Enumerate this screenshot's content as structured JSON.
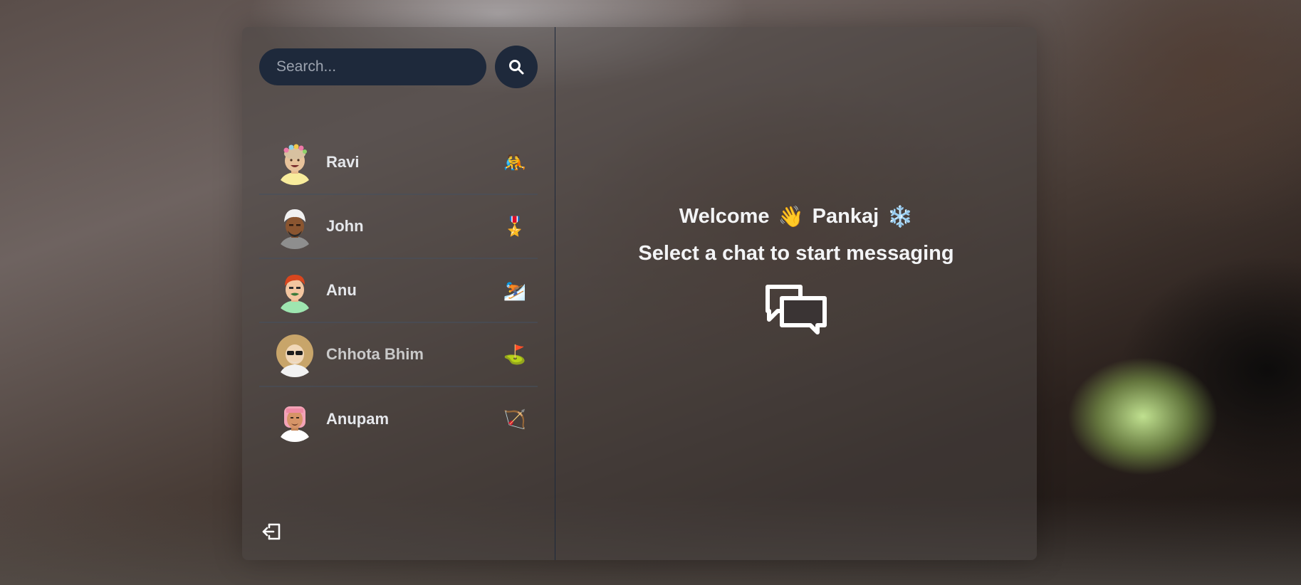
{
  "search": {
    "placeholder": "Search..."
  },
  "conversations": [
    {
      "name": "Ravi",
      "emoji": "🤼",
      "avatar_icon": "avatar-flower-crown-icon"
    },
    {
      "name": "John",
      "emoji": "🎖️",
      "avatar_icon": "avatar-turban-icon"
    },
    {
      "name": "Anu",
      "emoji": "⛷️",
      "avatar_icon": "avatar-red-hair-icon"
    },
    {
      "name": "Chhota Bhim",
      "emoji": "⛳",
      "avatar_icon": "avatar-sunglasses-icon"
    },
    {
      "name": "Anupam",
      "emoji": "🏹",
      "avatar_icon": "avatar-pink-headband-icon"
    }
  ],
  "main": {
    "welcome": "Welcome",
    "wave_emoji": "👋",
    "user_name": "Pankaj",
    "snow_emoji": "❄️",
    "subtitle": "Select a chat to start messaging"
  },
  "colors": {
    "input_bg": "#1e293b",
    "panel_bg": "rgba(75,70,68,0.55)",
    "text": "#e5e7eb"
  },
  "icons": [
    "search-icon",
    "logout-icon",
    "chat-bubbles-icon"
  ]
}
